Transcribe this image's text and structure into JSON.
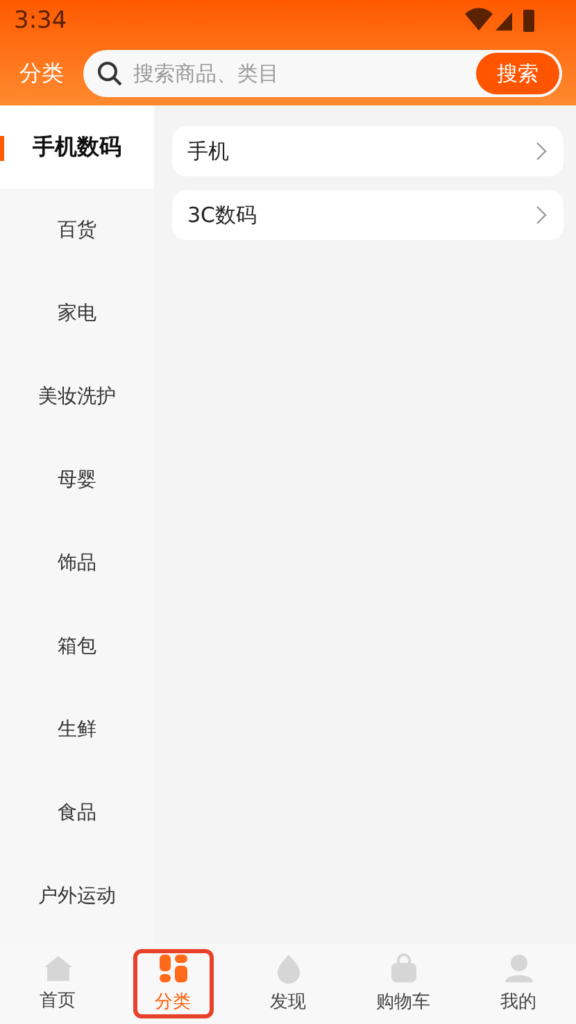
{
  "status_bar": {
    "time": "3:34"
  },
  "header": {
    "title": "分类",
    "search": {
      "placeholder": "搜索商品、类目",
      "button": "搜索"
    }
  },
  "sidebar": {
    "items": [
      {
        "label": "手机数码",
        "selected": true
      },
      {
        "label": "百货",
        "selected": false
      },
      {
        "label": "家电",
        "selected": false
      },
      {
        "label": "美妆洗护",
        "selected": false
      },
      {
        "label": "母婴",
        "selected": false
      },
      {
        "label": "饰品",
        "selected": false
      },
      {
        "label": "箱包",
        "selected": false
      },
      {
        "label": "生鲜",
        "selected": false
      },
      {
        "label": "食品",
        "selected": false
      },
      {
        "label": "户外运动",
        "selected": false
      }
    ]
  },
  "subcategories": [
    {
      "label": "手机"
    },
    {
      "label": "3C数码"
    }
  ],
  "tab_bar": {
    "items": [
      {
        "kind": "home",
        "label": "首页",
        "selected": false
      },
      {
        "kind": "category",
        "label": "分类",
        "selected": true
      },
      {
        "kind": "discover",
        "label": "发现",
        "selected": false
      },
      {
        "kind": "cart",
        "label": "购物车",
        "selected": false
      },
      {
        "kind": "profile",
        "label": "我的",
        "selected": false
      }
    ]
  }
}
